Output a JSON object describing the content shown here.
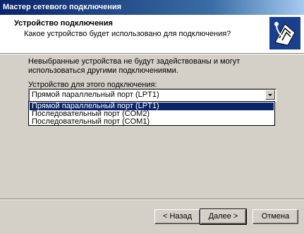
{
  "window": {
    "title": "Мастер сетевого подключения"
  },
  "header": {
    "title": "Устройство подключения",
    "subtitle": "Какое устройство будет использовано для подключения?",
    "icon": "network-cable-icon"
  },
  "main": {
    "description": "Невыбранные устройства не будут задействованы и могут использоваться другими подключениями.",
    "device_label": "Устройство для этого подключения:",
    "device_selected": "Прямой параллельный порт (LPT1)",
    "device_options": [
      "Прямой параллельный порт (LPT1)",
      "Последовательный порт (COM2)",
      "Последовательный порт (COM1)"
    ]
  },
  "buttons": {
    "back": "< Назад",
    "next": "Далее >",
    "cancel": "Отмена"
  }
}
